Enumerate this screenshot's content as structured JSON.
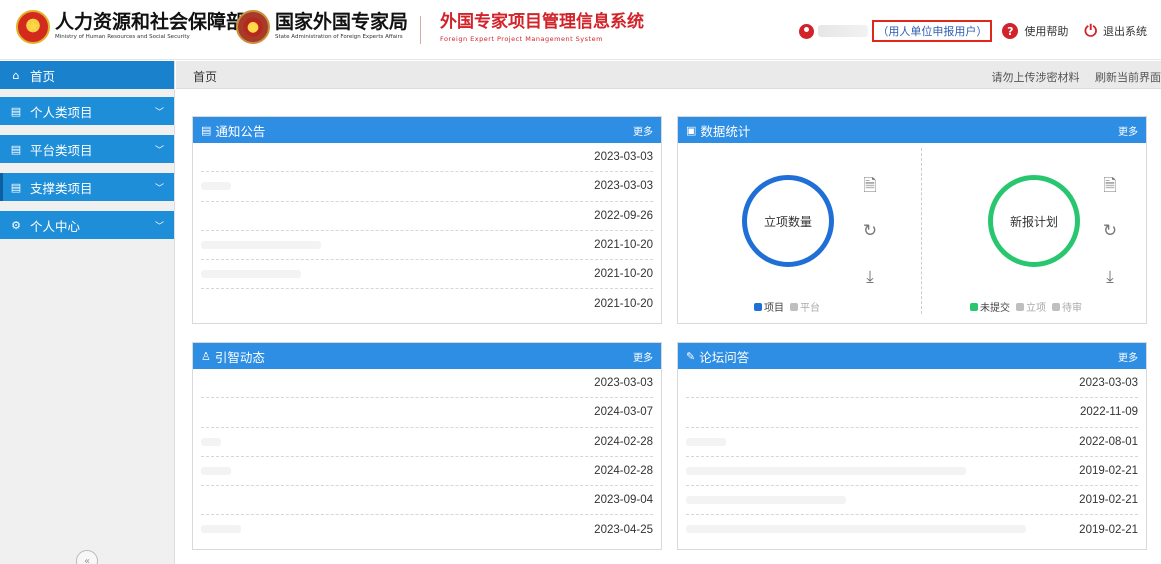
{
  "header": {
    "org1_cn": "人力资源和社会保障部",
    "org1_en": "Ministry of Human Resources and Social Security",
    "org2_cn": "国家外国专家局",
    "org2_en": "State Administration of Foreign Experts Affairs",
    "system_cn": "外国专家项目管理信息系统",
    "system_en": "Foreign Expert Project Management System",
    "user_role": "（用人单位申报用户）",
    "help_label": "使用帮助",
    "logout_label": "退出系统"
  },
  "sidebar": {
    "items": [
      {
        "label": "首页",
        "icon": "home-icon"
      },
      {
        "label": "个人类项目",
        "icon": "calendar-icon"
      },
      {
        "label": "平台类项目",
        "icon": "calendar-icon"
      },
      {
        "label": "支撑类项目",
        "icon": "calendar-icon"
      },
      {
        "label": "个人中心",
        "icon": "settings-icon"
      }
    ]
  },
  "breadcrumb": {
    "current": "首页",
    "notice": "请勿上传涉密材料",
    "refresh": "刷新当前界面"
  },
  "panels": {
    "announcements": {
      "title": "通知公告",
      "more": "更多",
      "dates": [
        "2023-03-03",
        "2023-03-03",
        "2022-09-26",
        "2021-10-20",
        "2021-10-20",
        "2021-10-20"
      ]
    },
    "stats": {
      "title": "数据统计",
      "more": "更多",
      "left_ring": "立项数量",
      "right_ring": "新报计划",
      "left_legend": [
        "项目",
        "平台"
      ],
      "right_legend": [
        "未提交",
        "立项",
        "待审"
      ],
      "colors": {
        "blue": "#1f6fd6",
        "green": "#28c76f",
        "gray": "#bfbfbf"
      }
    },
    "talent": {
      "title": "引智动态",
      "more": "更多",
      "dates": [
        "2023-03-03",
        "2024-03-07",
        "2024-02-28",
        "2024-02-28",
        "2023-09-04",
        "2023-04-25"
      ]
    },
    "forum": {
      "title": "论坛问答",
      "more": "更多",
      "dates": [
        "2023-03-03",
        "2022-11-09",
        "2022-08-01",
        "2019-02-21",
        "2019-02-21",
        "2019-02-21"
      ]
    }
  },
  "colors": {
    "accent": "#2e8ee3",
    "sidebar": "#1f8ed9",
    "brand_red": "#d2232a"
  }
}
